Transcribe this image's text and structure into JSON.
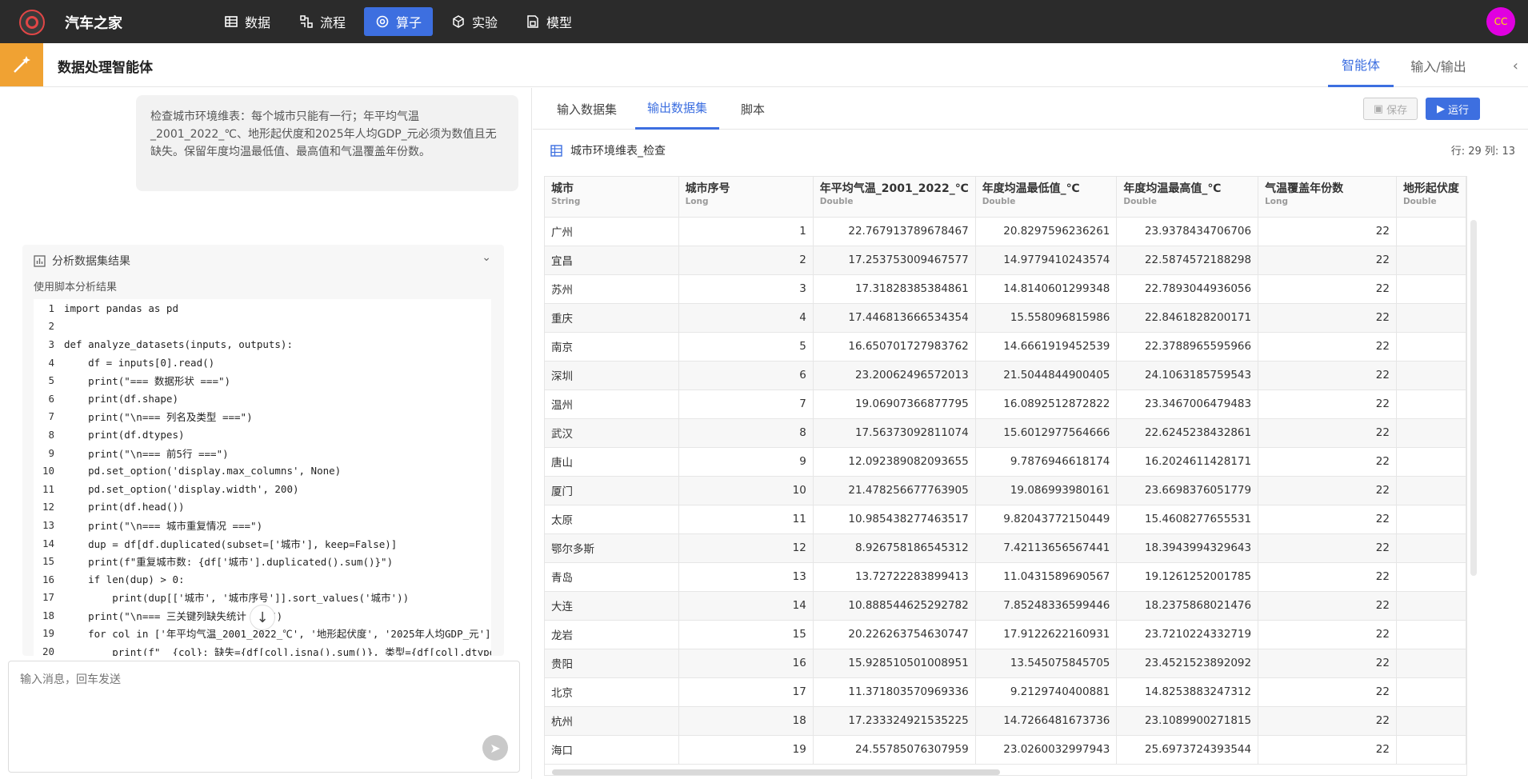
{
  "nav": {
    "app_name": "汽车之家",
    "items": [
      {
        "label": "数据",
        "icon": "table-icon"
      },
      {
        "label": "流程",
        "icon": "flow-icon"
      },
      {
        "label": "算子",
        "icon": "operator-icon"
      },
      {
        "label": "实验",
        "icon": "cube-icon"
      },
      {
        "label": "模型",
        "icon": "model-icon"
      }
    ],
    "active_index": 2,
    "avatar_text": "CC"
  },
  "header": {
    "title": "数据处理智能体",
    "tabs": [
      "智能体",
      "输入/输出"
    ],
    "active_tab": 0
  },
  "chat": {
    "message": "检查城市环境维表：每个城市只能有一行；年平均气温_2001_2022_℃、地形起伏度和2025年人均GDP_元必须为数值且无缺失。保留年度均温最低值、最高值和气温覆盖年份数。",
    "analysis": {
      "title": "分析数据集结果",
      "subtitle": "使用脚本分析结果"
    },
    "input_placeholder": "输入消息，回车发送"
  },
  "code_lines": [
    "import pandas as pd",
    "",
    "def analyze_datasets(inputs, outputs):",
    "    df = inputs[0].read()",
    "    print(\"=== 数据形状 ===\")",
    "    print(df.shape)",
    "    print(\"\\n=== 列名及类型 ===\")",
    "    print(df.dtypes)",
    "    print(\"\\n=== 前5行 ===\")",
    "    pd.set_option('display.max_columns', None)",
    "    pd.set_option('display.width', 200)",
    "    print(df.head())",
    "    print(\"\\n=== 城市重复情况 ===\")",
    "    dup = df[df.duplicated(subset=['城市'], keep=False)]",
    "    print(f\"重复城市数: {df['城市'].duplicated().sum()}\")",
    "    if len(dup) > 0:",
    "        print(dup[['城市', '城市序号']].sort_values('城市'))",
    "    print(\"\\n=== 三关键列缺失统计 ===\")",
    "    for col in ['年平均气温_2001_2022_℃', '地形起伏度', '2025年人均GDP_元']:",
    "        print(f\"  {col}: 缺失={df[col].isna().sum()}, 类型={df[col].dtype}\")"
  ],
  "dataset": {
    "tabs": [
      "输入数据集",
      "输出数据集",
      "脚本"
    ],
    "active_tab": 1,
    "save_label": "保存",
    "run_label": "运行",
    "name": "城市环境维表_检查",
    "meta": "行: 29 列: 13",
    "columns": [
      {
        "name": "城市",
        "type": "String"
      },
      {
        "name": "城市序号",
        "type": "Long"
      },
      {
        "name": "年平均气温_2001_2022_℃",
        "type": "Double"
      },
      {
        "name": "年度均温最低值_℃",
        "type": "Double"
      },
      {
        "name": "年度均温最高值_℃",
        "type": "Double"
      },
      {
        "name": "气温覆盖年份数",
        "type": "Long"
      },
      {
        "name": "地形起伏度",
        "type": "Double"
      }
    ],
    "rows": [
      [
        "广州",
        "1",
        "22.767913789678467",
        "20.8297596236261",
        "23.9378434706706",
        "22",
        ""
      ],
      [
        "宜昌",
        "2",
        "17.253753009467577",
        "14.9779410243574",
        "22.5874572188298",
        "22",
        ""
      ],
      [
        "苏州",
        "3",
        "17.31828385384861",
        "14.8140601299348",
        "22.7893044936056",
        "22",
        ""
      ],
      [
        "重庆",
        "4",
        "17.446813666534354",
        "15.558096815986",
        "22.8461828200171",
        "22",
        ""
      ],
      [
        "南京",
        "5",
        "16.650701727983762",
        "14.6661919452539",
        "22.3788965595966",
        "22",
        ""
      ],
      [
        "深圳",
        "6",
        "23.20062496572013",
        "21.5044844900405",
        "24.1063185759543",
        "22",
        ""
      ],
      [
        "温州",
        "7",
        "19.06907366877795",
        "16.0892512872822",
        "23.3467006479483",
        "22",
        ""
      ],
      [
        "武汉",
        "8",
        "17.56373092811074",
        "15.6012977564666",
        "22.6245238432861",
        "22",
        ""
      ],
      [
        "唐山",
        "9",
        "12.092389082093655",
        "9.7876946618174",
        "16.2024611428171",
        "22",
        ""
      ],
      [
        "厦门",
        "10",
        "21.478256677763905",
        "19.086993980161",
        "23.6698376051779",
        "22",
        ""
      ],
      [
        "太原",
        "11",
        "10.985438277463517",
        "9.82043772150449",
        "15.4608277655531",
        "22",
        ""
      ],
      [
        "鄂尔多斯",
        "12",
        "8.926758186545312",
        "7.42113656567441",
        "18.3943994329643",
        "22",
        ""
      ],
      [
        "青岛",
        "13",
        "13.72722283899413",
        "11.0431589690567",
        "19.1261252001785",
        "22",
        ""
      ],
      [
        "大连",
        "14",
        "10.888544625292782",
        "7.85248336599446",
        "18.2375868021476",
        "22",
        ""
      ],
      [
        "龙岩",
        "15",
        "20.226263754630747",
        "17.9122622160931",
        "23.7210224332719",
        "22",
        ""
      ],
      [
        "贵阳",
        "16",
        "15.928510501008951",
        "13.545075845705",
        "23.4521523892092",
        "22",
        ""
      ],
      [
        "北京",
        "17",
        "11.371803570969336",
        "9.2129740400881",
        "14.8253883247312",
        "22",
        ""
      ],
      [
        "杭州",
        "18",
        "17.233324921535225",
        "14.7266481673736",
        "23.1089900271815",
        "22",
        ""
      ],
      [
        "海口",
        "19",
        "24.55785076307959",
        "23.0260032997943",
        "25.6973724393544",
        "22",
        ""
      ]
    ]
  },
  "colors": {
    "nav_bg": "#2b2b2b",
    "accent": "#3d6fe0",
    "agent_icon_bg": "#f0a233",
    "avatar_bg": "#e000e0"
  }
}
